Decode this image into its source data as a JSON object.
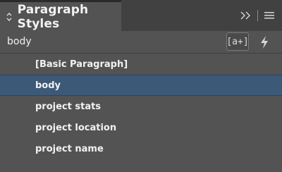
{
  "panel": {
    "tab_title": "Paragraph Styles",
    "icons": {
      "sort": "up-down-chevron-icon",
      "collapse": "double-chevron-right-icon",
      "menu": "hamburger-menu-icon",
      "quick_apply": "lightning-bolt-icon"
    }
  },
  "subheader": {
    "current_style": "body",
    "new_group_label": "[a+]"
  },
  "styles": [
    {
      "label": "[Basic Paragraph]",
      "selected": false
    },
    {
      "label": "body",
      "selected": true
    },
    {
      "label": "project stats",
      "selected": false
    },
    {
      "label": "project location",
      "selected": false
    },
    {
      "label": "project name",
      "selected": false
    }
  ],
  "colors": {
    "panel_bg": "#535353",
    "tab_strip_bg": "#414141",
    "selection_bg": "#3c5a78",
    "text": "#f2f2f2"
  }
}
